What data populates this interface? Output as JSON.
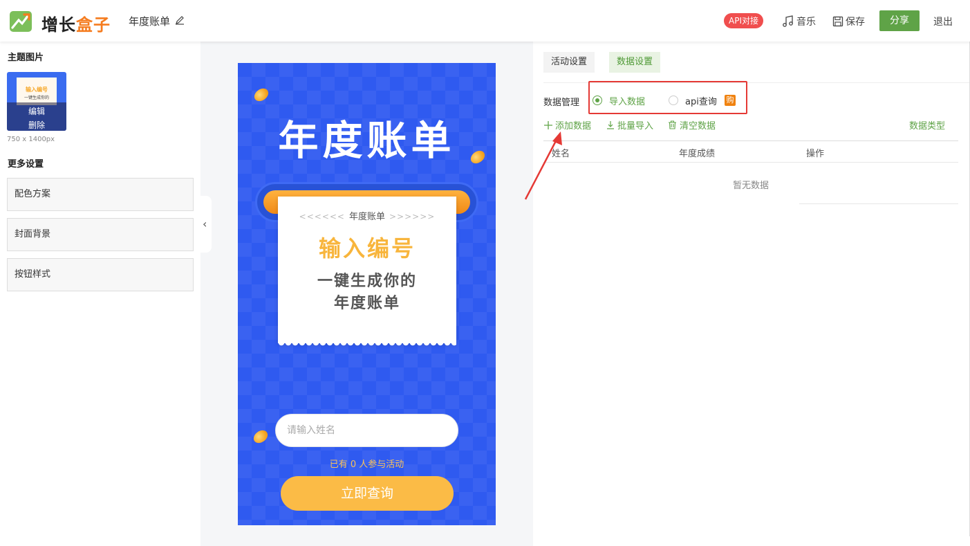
{
  "header": {
    "brand_part1": "增长",
    "brand_part2": "盒子",
    "doc_title": "年度账单",
    "api_badge": "API对接",
    "music_label": "音乐",
    "save_label": "保存",
    "share_label": "分享",
    "logout_label": "退出"
  },
  "left": {
    "theme_title": "主题图片",
    "thumb_edit": "编辑",
    "thumb_delete": "删除",
    "thumb_line1": "输入编号",
    "thumb_line2": "一键生成你的",
    "dimensions": "750 x 1400px",
    "more_title": "更多设置",
    "settings": [
      "配色方案",
      "封面背景",
      "按钮样式"
    ]
  },
  "preview": {
    "big_title": "年度账单",
    "receipt_subtitle": "年度账单",
    "receipt_deco_left": "<<<<<<",
    "receipt_deco_right": ">>>>>>",
    "receipt_main": "输入编号",
    "receipt_line1": "一键生成你的",
    "receipt_line2": "年度账单",
    "name_placeholder": "请输入姓名",
    "participants": "已有 0 人参与活动",
    "query_button": "立即查询"
  },
  "right": {
    "tabs": [
      "活动设置",
      "数据设置"
    ],
    "active_tab": "数据设置",
    "data_mgmt_label": "数据管理",
    "radio_import": "导入数据",
    "radio_api": "api查询",
    "buy_badge": "购",
    "actions": [
      "添加数据",
      "批量导入",
      "清空数据"
    ],
    "data_type": "数据类型",
    "columns": [
      "姓名",
      "年度成绩",
      "操作"
    ],
    "empty_text": "暂无数据"
  },
  "colors": {
    "brand_green": "#5fa347",
    "brand_orange": "#f57c1f",
    "preview_blue": "#2f5af0",
    "highlight_red": "#e53935",
    "button_yellow": "#fbbb46"
  },
  "icons": [
    "logo-icon",
    "edit-pencil-icon",
    "music-note-icon",
    "save-disk-icon",
    "plus-icon",
    "download-icon",
    "trash-icon",
    "chevron-left-icon"
  ]
}
